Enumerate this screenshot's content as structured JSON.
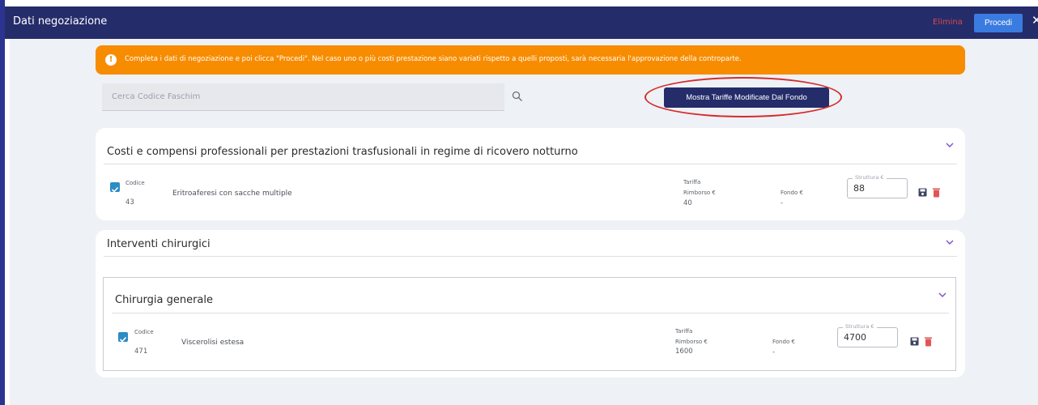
{
  "header": {
    "title": "Dati negoziazione",
    "delete_label": "Elimina",
    "proceed_label": "Procedi",
    "close_symbol": "✕"
  },
  "alert": {
    "icon": "!",
    "text": "Completa i dati di negoziazione e poi clicca \"Procedi\". Nel caso uno o più costi prestazione siano variati rispetto a quelli proposti, sarà necessaria l'approvazione della controparte."
  },
  "search": {
    "placeholder": "Cerca Codice Faschim"
  },
  "show_modified_button": "Mostra Tariffe Modificate Dal Fondo",
  "sections": [
    {
      "title": "Costi e compensi professionali per prestazioni trasfusionali in regime di ricovero notturno",
      "rows": [
        {
          "code_label": "Codice",
          "code": "43",
          "description": "Eritroaferesi con sacche multiple",
          "tariff_label_1": "Tariffa",
          "tariff_label_2": "Rimborso €",
          "tariff_value": "40",
          "fund_label": "Fondo €",
          "fund_value": "-",
          "structure_label": "Struttura €",
          "structure_value": "88",
          "checked": true
        }
      ]
    },
    {
      "title": "Interventi chirurgici",
      "subsections": [
        {
          "title": "Chirurgia generale",
          "rows": [
            {
              "code_label": "Codice",
              "code": "471",
              "description": "Viscerolisi estesa",
              "tariff_label_1": "Tariffa",
              "tariff_label_2": "Rimborso €",
              "tariff_value": "1600",
              "fund_label": "Fondo €",
              "fund_value": "-",
              "structure_label": "Struttura €",
              "structure_value": "4700",
              "checked": true
            }
          ]
        }
      ]
    }
  ],
  "colors": {
    "primary": "#252c6a",
    "alert": "#f78c00",
    "danger": "#d9464b",
    "accent": "#3a7be0",
    "checkbox": "#2d8cc4",
    "highlight_ellipse": "#d42c2c"
  },
  "icons": [
    "alert-icon",
    "search-icon",
    "chevron-down-icon",
    "checkbox-checked-icon",
    "save-icon",
    "trash-icon",
    "close-icon"
  ]
}
